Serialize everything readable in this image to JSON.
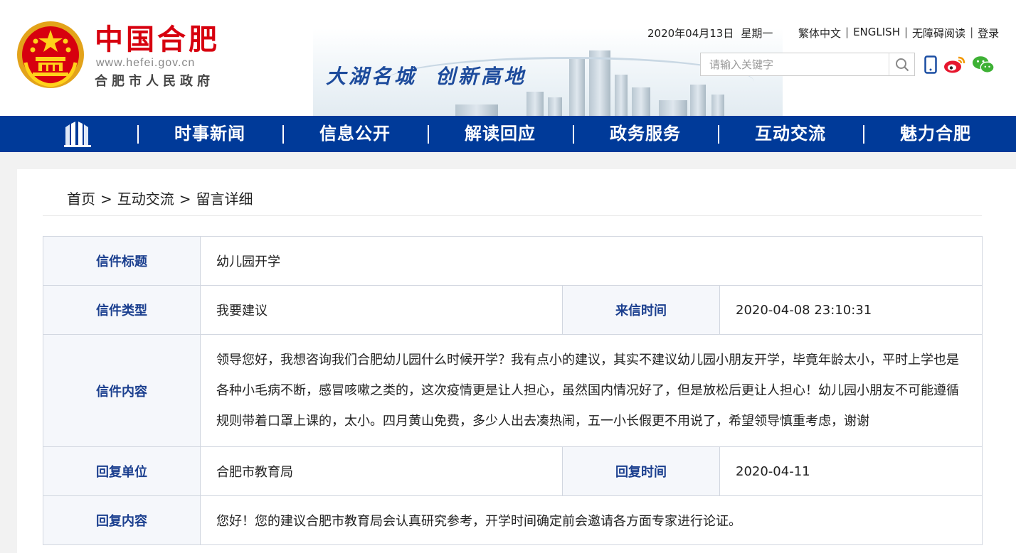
{
  "header": {
    "site_name": "中国合肥",
    "site_domain": "www.hefei.gov.cn",
    "site_subtitle": "合肥市人民政府",
    "slogan": [
      "大湖名城",
      "创新高地"
    ],
    "date": "2020年04月13日",
    "weekday": "星期一",
    "top_links": [
      "繁体中文",
      "ENGLISH",
      "无障碍阅读",
      "登录"
    ],
    "search": {
      "placeholder": "请输入关键字",
      "button_icon": "search-icon"
    },
    "social_icons": [
      "mobile-icon",
      "weibo-icon",
      "wechat-icon"
    ]
  },
  "nav": {
    "home_icon": "building-home-icon",
    "items": [
      "时事新闻",
      "信息公开",
      "解读回应",
      "政务服务",
      "互动交流",
      "魅力合肥"
    ]
  },
  "breadcrumb": [
    "首页",
    "互动交流",
    "留言详细"
  ],
  "letter": {
    "title_label": "信件标题",
    "title": "幼儿园开学",
    "type_label": "信件类型",
    "type": "我要建议",
    "received_label": "来信时间",
    "received": "2020-04-08 23:10:31",
    "content_label": "信件内容",
    "content": "领导您好，我想咨询我们合肥幼儿园什么时候开学？我有点小的建议，其实不建议幼儿园小朋友开学，毕竟年龄太小，平时上学也是各种小毛病不断，感冒咳嗽之类的，这次疫情更是让人担心，虽然国内情况好了，但是放松后更让人担心！幼儿园小朋友不可能遵循规则带着口罩上课的，太小。四月黄山免费，多少人出去凑热闹，五一小长假更不用说了，希望领导慎重考虑，谢谢",
    "reply_unit_label": "回复单位",
    "reply_unit": "合肥市教育局",
    "reply_time_label": "回复时间",
    "reply_time": "2020-04-11",
    "reply_content_label": "回复内容",
    "reply_content": "您好！您的建议合肥市教育局会认真研究参考，开学时间确定前会邀请各方面专家进行论证。"
  },
  "colors": {
    "nav_bg": "#003a99",
    "brand_red": "#d7000f",
    "label_blue": "#1b3f8f"
  }
}
